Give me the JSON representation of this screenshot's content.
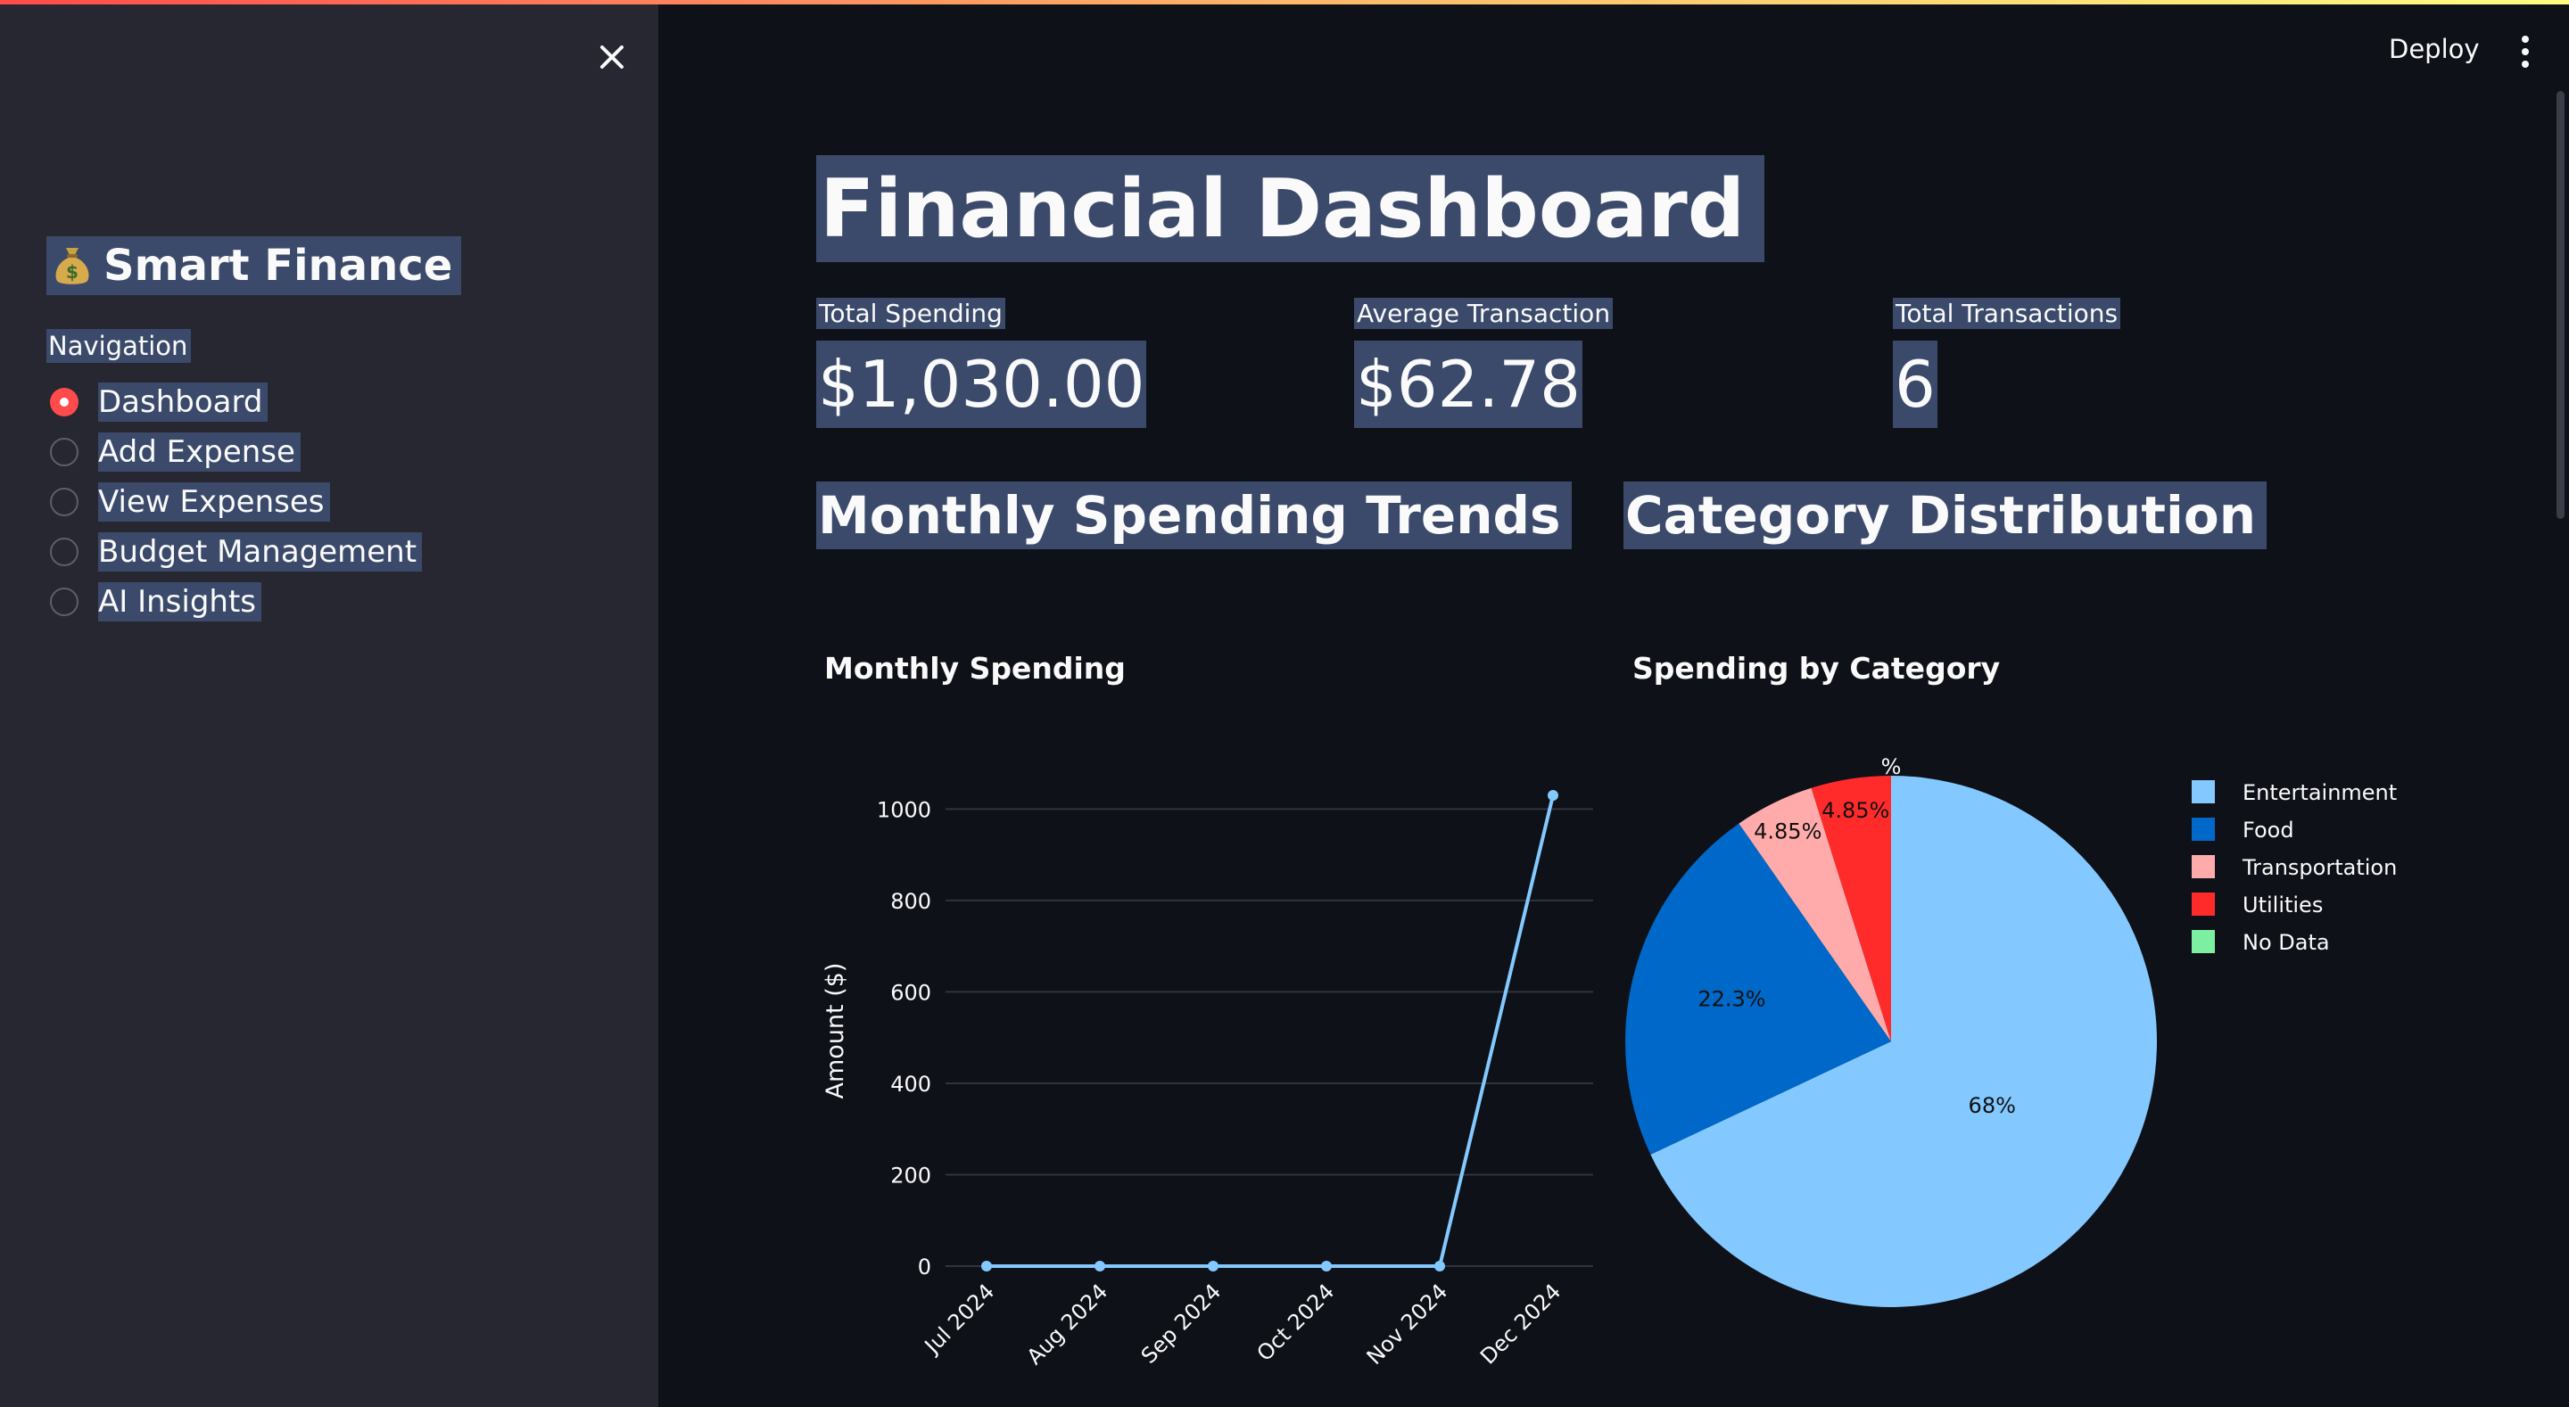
{
  "header": {
    "deploy_label": "Deploy"
  },
  "sidebar": {
    "app_title": "Smart Finance",
    "app_icon": "money-bag-icon",
    "nav_label": "Navigation",
    "items": [
      {
        "label": "Dashboard",
        "selected": true
      },
      {
        "label": "Add Expense",
        "selected": false
      },
      {
        "label": "View Expenses",
        "selected": false
      },
      {
        "label": "Budget Management",
        "selected": false
      },
      {
        "label": "AI Insights",
        "selected": false
      }
    ]
  },
  "main": {
    "title": "Financial Dashboard",
    "metrics": [
      {
        "label": "Total Spending",
        "value": "$1,030.00"
      },
      {
        "label": "Average Transaction",
        "value": "$62.78"
      },
      {
        "label": "Total Transactions",
        "value": "6"
      }
    ],
    "sections": {
      "trends": "Monthly Spending Trends",
      "distribution": "Category Distribution"
    }
  },
  "colors": {
    "accent": "#ff4b4b",
    "background": "#0e1117",
    "sidebar": "#262730",
    "highlight": "#3b4a6b"
  },
  "chart_data": [
    {
      "type": "line",
      "title": "Monthly Spending",
      "xlabel": "",
      "ylabel": "Amount ($)",
      "x": [
        "Jul 2024",
        "Aug 2024",
        "Sep 2024",
        "Oct 2024",
        "Nov 2024",
        "Dec 2024"
      ],
      "y": [
        0,
        0,
        0,
        0,
        0,
        1030
      ],
      "yticks": [
        0,
        200,
        400,
        600,
        800,
        1000
      ],
      "ylim": [
        0,
        1030
      ],
      "grid": true,
      "color": "#83c9ff"
    },
    {
      "type": "pie",
      "title": "Spending by Category",
      "legend_position": "right",
      "slices": [
        {
          "label": "Entertainment",
          "value": 68,
          "text": "68%",
          "color": "#83c9ff"
        },
        {
          "label": "Food",
          "value": 22.3,
          "text": "22.3%",
          "color": "#0068c9"
        },
        {
          "label": "Transportation",
          "value": 4.85,
          "text": "4.85%",
          "color": "#ffabab"
        },
        {
          "label": "Utilities",
          "value": 4.85,
          "text": "4.85%",
          "color": "#ff2b2b"
        },
        {
          "label": "No Data",
          "value": 0,
          "text": "%",
          "color": "#7defa1"
        }
      ]
    }
  ]
}
